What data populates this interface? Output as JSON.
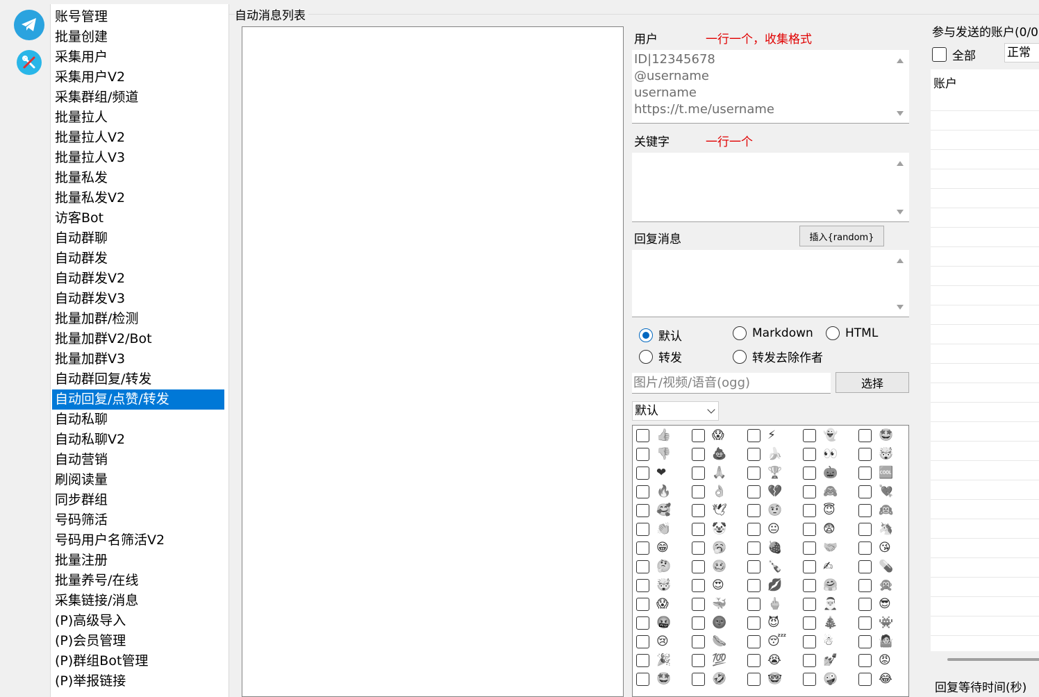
{
  "rail": {
    "icons": [
      "telegram-icon",
      "tools-icon"
    ]
  },
  "nav": {
    "items": [
      "账号管理",
      "批量创建",
      "采集用户",
      "采集用户V2",
      "采集群组/频道",
      "批量拉人",
      "批量拉人V2",
      "批量拉人V3",
      "批量私发",
      "批量私发V2",
      "访客Bot",
      "自动群聊",
      "自动群发",
      "自动群发V2",
      "自动群发V3",
      "批量加群/检测",
      "批量加群V2/Bot",
      "批量加群V3",
      "自动群回复/转发",
      "自动回复/点赞/转发",
      "自动私聊",
      "自动私聊V2",
      "自动营销",
      "刷阅读量",
      "同步群组",
      "号码筛活",
      "号码用户名筛活V2",
      "批量注册",
      "批量养号/在线",
      "采集链接/消息",
      "(P)高级导入",
      "(P)会员管理",
      "(P)群组Bot管理",
      "(P)举报链接"
    ],
    "selected_index": 19,
    "selected_color": "#0078d7"
  },
  "group": {
    "title": "自动消息列表"
  },
  "users": {
    "label": "用户",
    "hint": "一行一个，收集格式",
    "placeholder": "ID|12345678\n@username\nusername\nhttps://t.me/username"
  },
  "keywords": {
    "label": "关键字",
    "hint": "一行一个"
  },
  "reply": {
    "label": "回复消息",
    "insert_button": "插入{random}"
  },
  "format": {
    "options": [
      "默认",
      "Markdown",
      "HTML",
      "转发",
      "转发去除作者"
    ],
    "selected": "默认"
  },
  "media": {
    "placeholder": "图片/视频/语音(ogg)",
    "choose_button": "选择"
  },
  "reaction_mode": {
    "selected": "默认"
  },
  "reactions": [
    "👍",
    "😱",
    "⚡",
    "👻",
    "🤩",
    "👎",
    "💩",
    "🍌",
    "👀",
    "🤯",
    "❤",
    "🙏",
    "🏆",
    "🎃",
    "🆒",
    "🔥",
    "👌",
    "💔",
    "🙈",
    "💘",
    "🥰",
    "🕊",
    "🤨",
    "😇",
    "🙉",
    "👏",
    "🤡",
    "😐",
    "😨",
    "🦄",
    "😁",
    "🥱",
    "🍓",
    "🤝",
    "😘",
    "🤔",
    "🥴",
    "🍾",
    "✍",
    "💊",
    "🤯",
    "😍",
    "💋",
    "🤗",
    "🙊",
    "😱",
    "🐳",
    "🖕",
    "🎅",
    "😎",
    "🤬",
    "🌚",
    "😈",
    "🎄",
    "👾",
    "😢",
    "🌭",
    "😴",
    "☃",
    "🤷",
    "🎉",
    "💯",
    "😭",
    "💅",
    "😡",
    "🤩",
    "🤣",
    "🤓",
    "🤪",
    "😂"
  ],
  "accounts": {
    "title": "参与发送的账户(0/0",
    "select_all": "全部",
    "status_filter": "正常",
    "column_header": "账户",
    "wait_label": "回复等待时间(秒)"
  }
}
